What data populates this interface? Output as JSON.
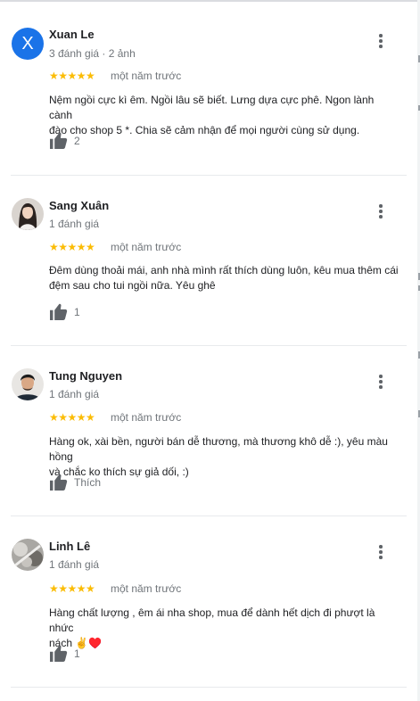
{
  "reviews": [
    {
      "name": "Xuan Le",
      "avatar_letter": "X",
      "meta": "3 đánh giá · 2 ảnh",
      "stars": "★★★★★",
      "time": "một năm trước",
      "text_lines": [
        "Nệm ngồi cực kì êm. Ngồi lâu sẽ biết. Lưng dựa cực phê. Ngon lành cành",
        "đào cho shop 5 *. Chia sẽ cảm nhận để mọi người cùng sử dụng."
      ],
      "like_label": "2"
    },
    {
      "name": "Sang Xuân",
      "meta": "1 đánh giá",
      "stars": "★★★★★",
      "time": "một năm trước",
      "text_lines": [
        "Đêm dùng thoải mái, anh nhà mình rất thích dùng luôn, kêu mua thêm cái",
        "đệm sau cho tui ngồi nữa. Yêu ghê"
      ],
      "like_label": "1"
    },
    {
      "name": "Tung Nguyen",
      "meta": "1 đánh giá",
      "stars": "★★★★★",
      "time": "một năm trước",
      "text_lines": [
        "Hàng ok, xài bền, người bán dễ thương, mà thương khô dễ :), yêu màu hồng",
        "và chắc ko thích sự giả dối, :)"
      ],
      "like_label": "Thích"
    },
    {
      "name": "Linh Lê",
      "meta": "1 đánh giá",
      "stars": "★★★★★",
      "time": "một năm trước",
      "text_lines": [
        "Hàng chất lượng , êm ái nha shop, mua để dành hết dịch đi phượt là nhức",
        "nách ✌️♥️"
      ],
      "like_label": "1"
    }
  ],
  "icons": {
    "more": "more-vert-icon",
    "like": "thumb-up-icon"
  },
  "colors": {
    "star": "#fbbc04",
    "avatar_letter_bg": "#1a73e8",
    "muted_text": "#70757a",
    "icon": "#5f6368"
  }
}
